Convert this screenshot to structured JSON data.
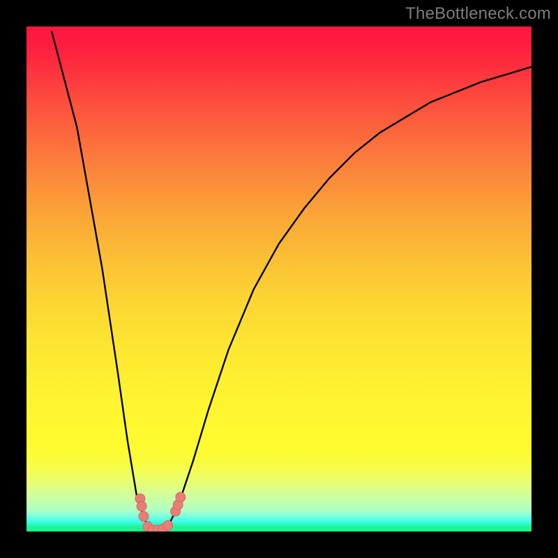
{
  "watermark": "TheBottleneck.com",
  "colors": {
    "background": "#000000",
    "curve": "#000000",
    "marker_fill": "#e97e77",
    "marker_stroke": "#d36a63",
    "watermark": "#7c7c7c"
  },
  "chart_data": {
    "type": "line",
    "title": "",
    "xlabel": "",
    "ylabel": "",
    "xlim": [
      0,
      100
    ],
    "ylim": [
      0,
      100
    ],
    "x": [
      0,
      5,
      10,
      15,
      18,
      20,
      22,
      24,
      25,
      26,
      27,
      28,
      30,
      33,
      36,
      40,
      45,
      50,
      55,
      60,
      65,
      70,
      75,
      80,
      85,
      90,
      95,
      100
    ],
    "series": [
      {
        "name": "bottleneck-curve",
        "values": [
          null,
          99,
          80,
          52,
          32,
          18,
          6,
          1,
          0,
          0,
          0,
          1,
          5,
          14,
          24,
          36,
          48,
          57,
          64,
          70,
          75,
          79,
          82,
          85,
          87,
          89,
          90.5,
          92
        ]
      }
    ],
    "markers": [
      {
        "x": 22.5,
        "y": 6.5
      },
      {
        "x": 22.8,
        "y": 5.0
      },
      {
        "x": 23.2,
        "y": 3.0
      },
      {
        "x": 24.0,
        "y": 1.0
      },
      {
        "x": 25.0,
        "y": 0.3
      },
      {
        "x": 26.0,
        "y": 0.3
      },
      {
        "x": 27.0,
        "y": 0.5
      },
      {
        "x": 28.0,
        "y": 1.2
      },
      {
        "x": 29.5,
        "y": 4.0
      },
      {
        "x": 30.0,
        "y": 5.3
      },
      {
        "x": 30.5,
        "y": 6.8
      }
    ]
  }
}
